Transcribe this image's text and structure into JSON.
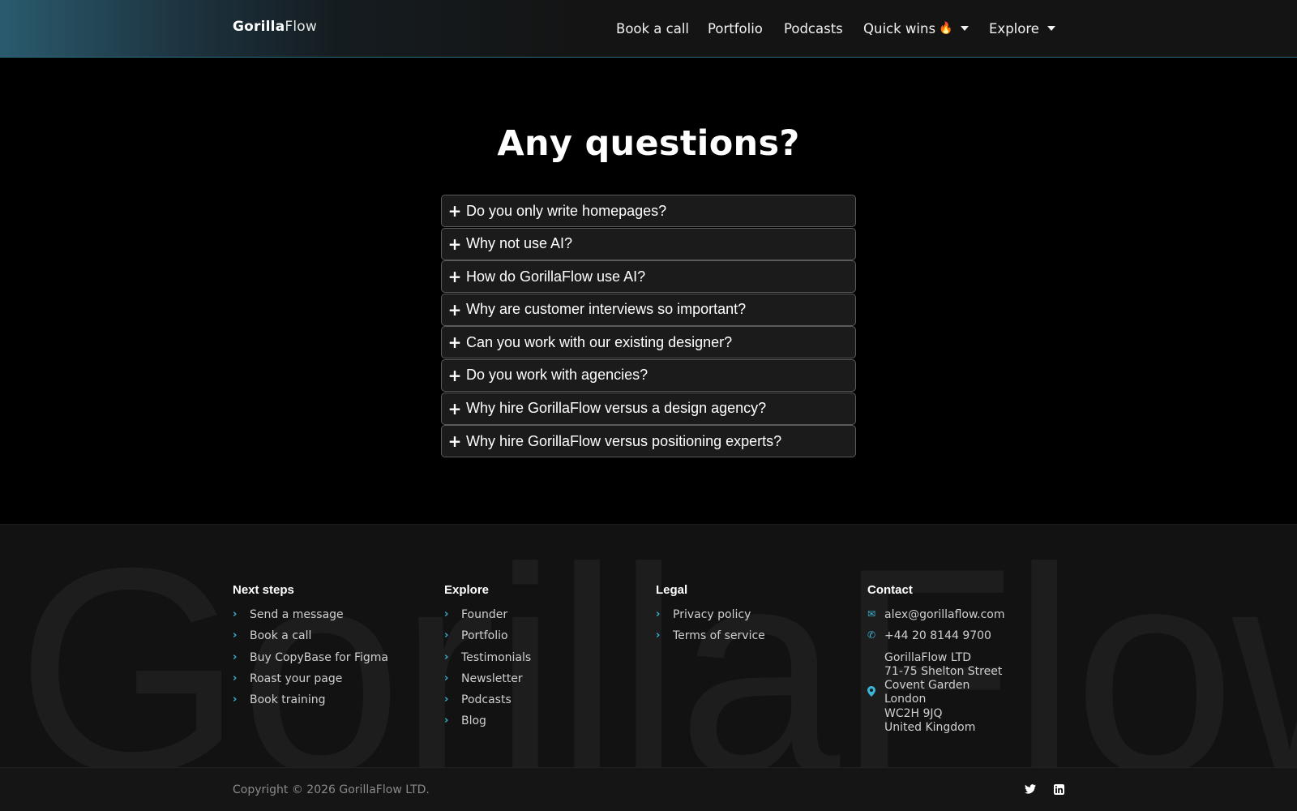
{
  "header": {
    "logo_bold": "Gorilla",
    "logo_light": "Flow",
    "nav": [
      {
        "label": "Book a call"
      },
      {
        "label": "Portfolio"
      },
      {
        "label": "Podcasts"
      },
      {
        "label": "Quick wins",
        "emoji": "🔥"
      },
      {
        "label": "Explore"
      }
    ]
  },
  "faq": {
    "title": "Any questions?",
    "items": [
      "Do you only write homepages?",
      "Why not use AI?",
      "How do GorillaFlow use AI?",
      "Why are customer interviews so important?",
      "Can you work with our existing designer?",
      "Do you work with agencies?",
      "Why hire GorillaFlow versus a design agency?",
      "Why hire GorillaFlow versus positioning experts?"
    ]
  },
  "footer": {
    "watermark": "GorillaFlow",
    "next_steps": {
      "heading": "Next steps",
      "links": [
        "Send a message",
        "Book a call",
        "Buy CopyBase for Figma",
        "Roast your page",
        "Book training"
      ]
    },
    "explore": {
      "heading": "Explore",
      "links": [
        "Founder",
        "Portfolio",
        "Testimonials",
        "Newsletter",
        "Podcasts",
        "Blog"
      ]
    },
    "legal": {
      "heading": "Legal",
      "links": [
        "Privacy policy",
        "Terms of service"
      ]
    },
    "contact": {
      "heading": "Contact",
      "email": "alex@gorillaflow.com",
      "phone": "+44 20 8144 9700",
      "address": [
        "GorillaFlow LTD",
        "71-75 Shelton Street",
        "Covent Garden",
        "London",
        "WC2H 9JQ",
        "United Kingdom"
      ]
    },
    "copyright": "Copyright © 2026 GorillaFlow LTD."
  },
  "colors": {
    "accent": "#39b6d6",
    "header_gradient_start": "#2a5b6e"
  }
}
